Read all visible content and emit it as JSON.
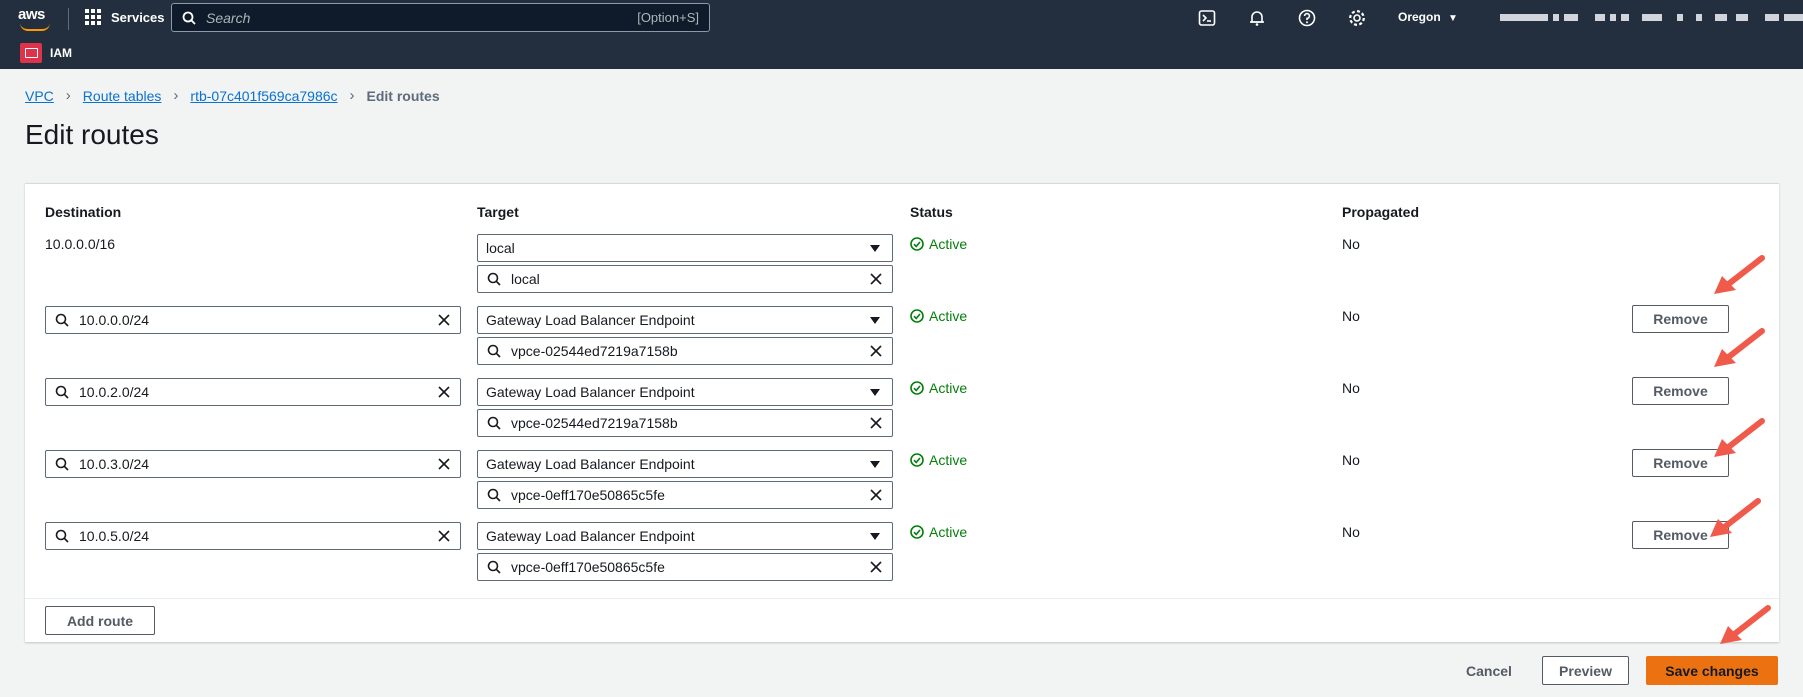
{
  "nav": {
    "logo": "aws",
    "services_label": "Services",
    "search_placeholder": "Search",
    "search_shortcut": "[Option+S]",
    "region": "Oregon",
    "service_name": "IAM",
    "icons": [
      "cloudshell-icon",
      "notifications-icon",
      "help-icon",
      "settings-icon"
    ]
  },
  "breadcrumb": {
    "items": [
      "VPC",
      "Route tables",
      "rtb-07c401f569ca7986c"
    ],
    "current": "Edit routes"
  },
  "page_title": "Edit routes",
  "table": {
    "headers": {
      "destination": "Destination",
      "target": "Target",
      "status": "Status",
      "propagated": "Propagated"
    },
    "rows": [
      {
        "destination": "10.0.0.0/16",
        "target_type": "local",
        "target_value": "local",
        "status": "Active",
        "propagated": "No"
      },
      {
        "destination": "10.0.0.0/24",
        "target_type": "Gateway Load Balancer Endpoint",
        "target_value": "vpce-02544ed7219a7158b",
        "status": "Active",
        "propagated": "No",
        "remove_label": "Remove"
      },
      {
        "destination": "10.0.2.0/24",
        "target_type": "Gateway Load Balancer Endpoint",
        "target_value": "vpce-02544ed7219a7158b",
        "status": "Active",
        "propagated": "No",
        "remove_label": "Remove"
      },
      {
        "destination": "10.0.3.0/24",
        "target_type": "Gateway Load Balancer Endpoint",
        "target_value": "vpce-0eff170e50865c5fe",
        "status": "Active",
        "propagated": "No",
        "remove_label": "Remove"
      },
      {
        "destination": "10.0.5.0/24",
        "target_type": "Gateway Load Balancer Endpoint",
        "target_value": "vpce-0eff170e50865c5fe",
        "status": "Active",
        "propagated": "No",
        "remove_label": "Remove"
      }
    ]
  },
  "actions": {
    "add_route": "Add route",
    "cancel": "Cancel",
    "preview": "Preview",
    "save": "Save changes"
  },
  "colors": {
    "nav_bg": "#232f3e",
    "link": "#0972d3",
    "active": "#037f0c",
    "primary": "#ec7211",
    "annotation_arrow": "#f05a4a"
  }
}
